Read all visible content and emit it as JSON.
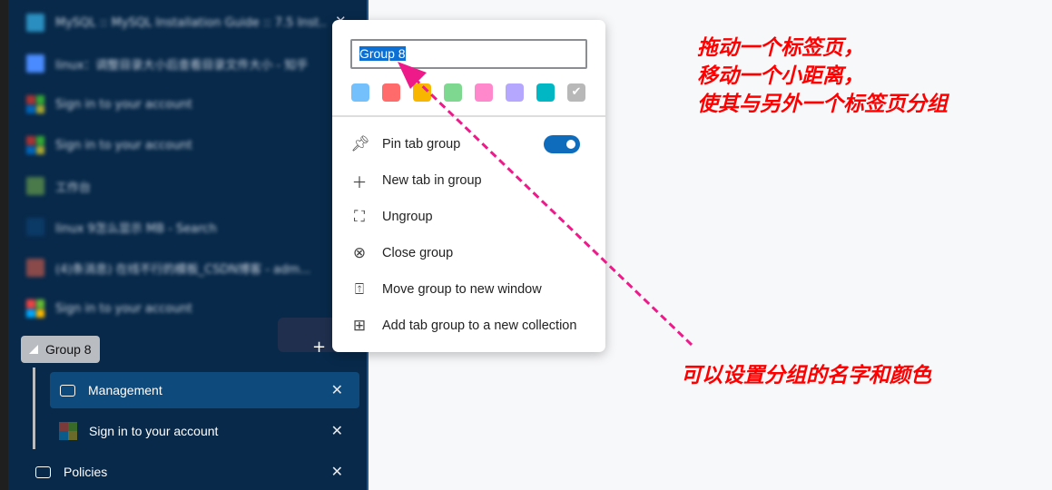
{
  "sidebar": {
    "blurred_tabs": [
      {
        "title": "MySQL :: MySQL Installation Guide :: 7.5 Inst..."
      },
      {
        "title": "linux：调整目录大小后查看目录文件大小 - 知乎"
      },
      {
        "title": "Sign in to your account"
      },
      {
        "title": "Sign in to your account"
      },
      {
        "title": "工作台"
      },
      {
        "title": "linux 9怎么显示 MB - Search"
      },
      {
        "title": "(4)条消息) 在线不行的模板_CSDN博客 - adm..."
      },
      {
        "title": "Sign in to your account"
      }
    ],
    "group": {
      "label": "Group 8"
    },
    "group_tabs": [
      {
        "title": "Management",
        "active": true
      },
      {
        "title": "Sign in to your account",
        "active": false
      }
    ],
    "after_group": {
      "title": "Policies"
    }
  },
  "menu": {
    "name_value": "Group 8",
    "colors": [
      "#74c0fc",
      "#ff6b6b",
      "#f9b600",
      "#7fd88f",
      "#ff87cb",
      "#b4a7fd",
      "#00b7c3",
      "#b8b8b8"
    ],
    "selected_color_index": 7,
    "items": [
      {
        "label": "Pin tab group",
        "icon": "pin-icon"
      },
      {
        "label": "New tab in group",
        "icon": "plus-icon"
      },
      {
        "label": "Ungroup",
        "icon": "ungroup-icon"
      },
      {
        "label": "Close group",
        "icon": "close-circle-icon"
      },
      {
        "label": "Move group to new window",
        "icon": "move-window-icon"
      },
      {
        "label": "Add tab group to a new collection",
        "icon": "collection-add-icon"
      }
    ],
    "pin_toggle_on": true
  },
  "annotations": {
    "top": [
      "拖动一个标签页，",
      "移动一个小距离，",
      "使其与另外一个标签页分组"
    ],
    "bottom": "可以设置分组的名字和颜色"
  }
}
